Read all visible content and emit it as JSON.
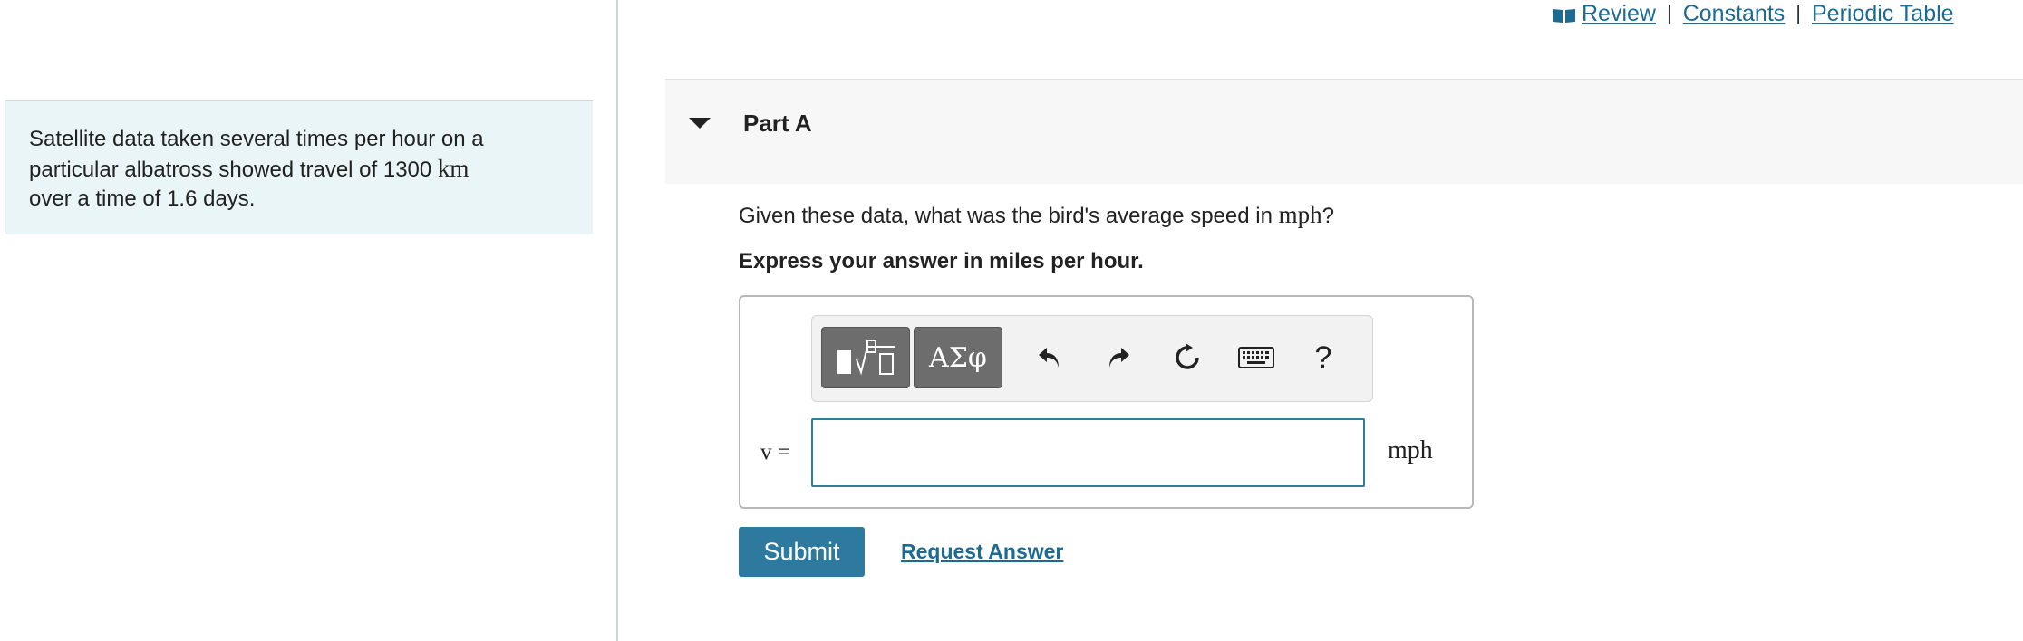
{
  "top_links": {
    "review": "Review",
    "separator": "|",
    "constants": "Constants",
    "periodic_table": "Periodic Table"
  },
  "problem": {
    "text_before": "Satellite data taken several times per hour on a particular albatross showed travel of 1300 ",
    "unit_km": "km",
    "text_after": " over a time of 1.6 days."
  },
  "part": {
    "title": "Part A"
  },
  "question": {
    "text_before": "Given these data, what was the bird's average speed in ",
    "unit": "mph",
    "text_after": "?"
  },
  "instruction": "Express your answer in miles per hour.",
  "toolbar": {
    "greek_label": "ΑΣφ",
    "help_label": "?",
    "icons": [
      "templates-icon",
      "greek-symbols-icon",
      "undo-icon",
      "redo-icon",
      "reset-icon",
      "keyboard-icon",
      "help-icon"
    ]
  },
  "answer": {
    "variable_label": "v =",
    "value": "",
    "placeholder": "",
    "unit": "mph"
  },
  "buttons": {
    "submit": "Submit",
    "request_answer": "Request Answer"
  },
  "colors": {
    "accent": "#2d7a9e",
    "link": "#1d6b92",
    "problem_bg": "#e9f5f7"
  }
}
